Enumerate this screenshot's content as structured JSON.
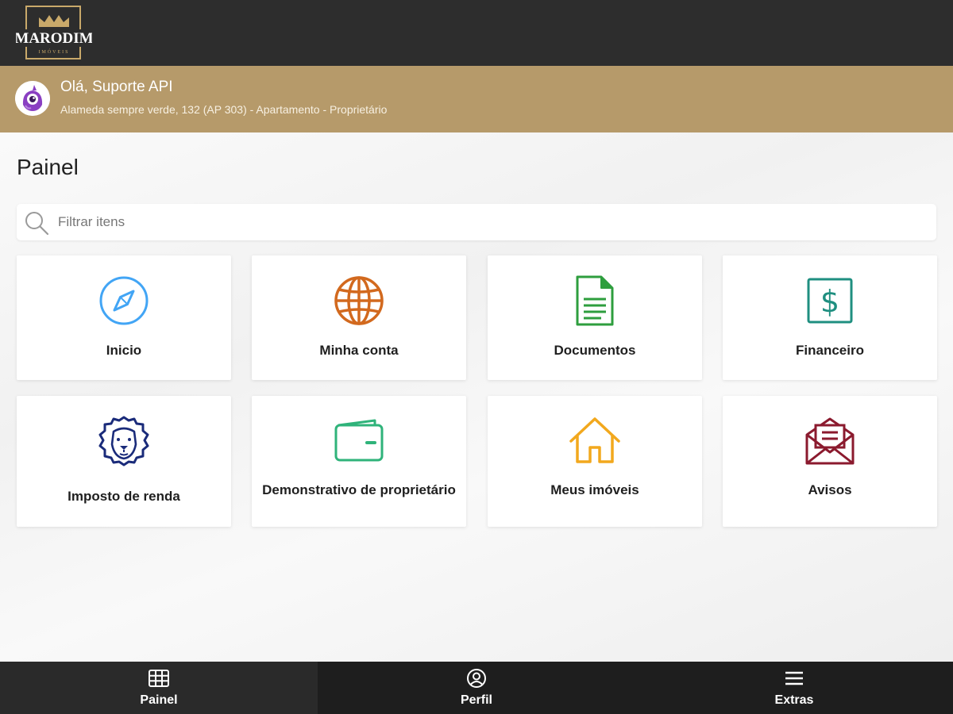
{
  "app": {
    "logo_text": "MARODIM",
    "logo_subtext": "IMÓVEIS"
  },
  "user": {
    "greeting": "Olá, Suporte API",
    "address": "Alameda sempre verde, 132 (AP 303) - Apartamento - Proprietário"
  },
  "main": {
    "title": "Painel",
    "search": {
      "placeholder": "Filtrar itens",
      "value": ""
    },
    "cards": [
      {
        "label": "Inicio",
        "icon": "compass-icon",
        "color": "#42a5f5"
      },
      {
        "label": "Minha conta",
        "icon": "globe-icon",
        "color": "#d2691e"
      },
      {
        "label": "Documentos",
        "icon": "document-icon",
        "color": "#2e9e3e"
      },
      {
        "label": "Financeiro",
        "icon": "dollar-icon",
        "color": "#1f8f80"
      },
      {
        "label": "Imposto de renda",
        "icon": "lion-icon",
        "color": "#1a2b7a"
      },
      {
        "label": "Demonstrativo de proprietário",
        "icon": "wallet-icon",
        "color": "#2fb37a"
      },
      {
        "label": "Meus imóveis",
        "icon": "house-icon",
        "color": "#f2a81d"
      },
      {
        "label": "Avisos",
        "icon": "mail-icon",
        "color": "#8b1a2e"
      }
    ]
  },
  "bottom_nav": [
    {
      "label": "Painel",
      "icon": "grid-icon",
      "active": true
    },
    {
      "label": "Perfil",
      "icon": "user-circle-icon",
      "active": false
    },
    {
      "label": "Extras",
      "icon": "menu-icon",
      "active": false
    }
  ],
  "colors": {
    "topbar": "#2d2d2d",
    "banner": "#b69a6a",
    "bottom_nav": "#1e1e1e",
    "logo_gold": "#c9a96a"
  }
}
